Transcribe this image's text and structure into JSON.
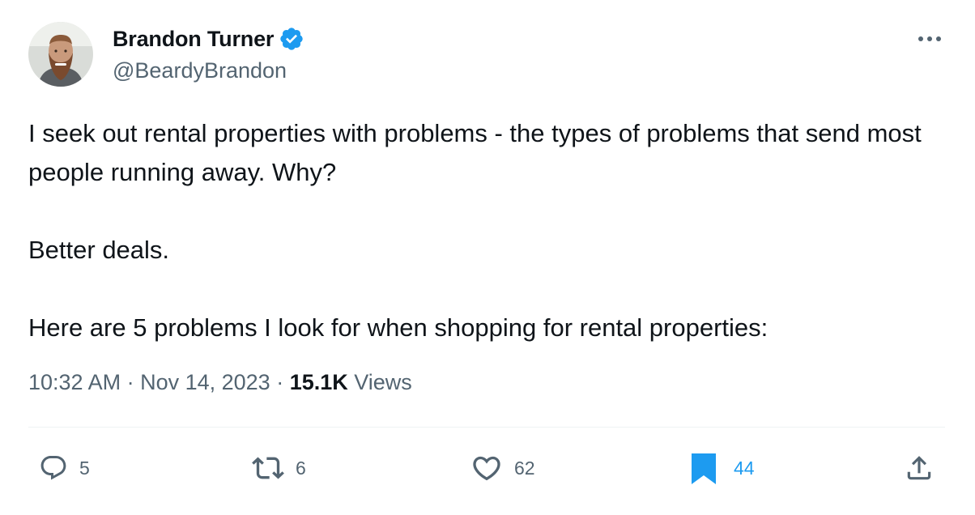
{
  "author": {
    "name": "Brandon Turner",
    "handle": "@BeardyBrandon",
    "verified": true
  },
  "tweet": {
    "paragraphs": [
      "I seek out rental properties with problems - the types of problems that send most people running away. Why?",
      "Better deals.",
      "Here are 5 problems I look for when shopping for rental properties:"
    ]
  },
  "meta": {
    "time": "10:32 AM",
    "separator": " · ",
    "date": "Nov 14, 2023",
    "views_count": "15.1K",
    "views_label": " Views"
  },
  "actions": {
    "replies": "5",
    "retweets": "6",
    "likes": "62",
    "bookmarks": "44"
  },
  "colors": {
    "primary_text": "#0f1419",
    "secondary_text": "#536471",
    "accent": "#1d9bf0",
    "divider": "#eff3f4"
  },
  "icons": {
    "verified": "verified-badge-icon",
    "more": "more-horizontal-icon",
    "reply": "reply-icon",
    "retweet": "retweet-icon",
    "like": "heart-icon",
    "bookmark": "bookmark-icon",
    "share": "share-icon"
  }
}
